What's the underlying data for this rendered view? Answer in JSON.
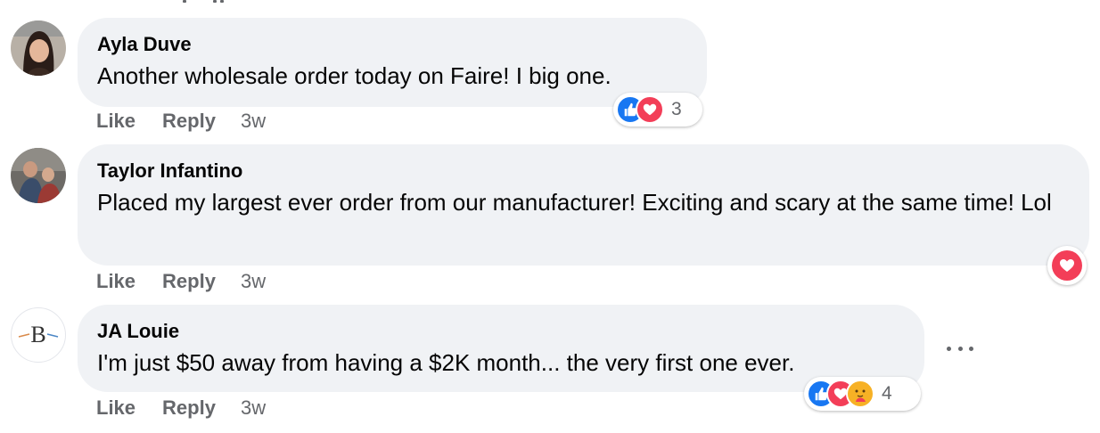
{
  "comments": [
    {
      "author": "Ayla Duve",
      "text": "Another wholesale order today on Faire! I big one.",
      "actions": {
        "like": "Like",
        "reply": "Reply",
        "time": "3w"
      },
      "reactions": {
        "types": [
          "like",
          "love"
        ],
        "count": "3"
      }
    },
    {
      "author": "Taylor Infantino",
      "text": "Placed my largest ever order from our manufacturer! Exciting and scary at the same time! Lol",
      "actions": {
        "like": "Like",
        "reply": "Reply",
        "time": "3w"
      },
      "reactions": {
        "types": [
          "love"
        ],
        "count": ""
      }
    },
    {
      "author": "JA Louie",
      "avatar_letter": "B",
      "text": "I'm just $50 away from having a $2K month... the very first one ever.",
      "actions": {
        "like": "Like",
        "reply": "Reply",
        "time": "3w"
      },
      "reactions": {
        "types": [
          "like",
          "love",
          "care"
        ],
        "count": "4"
      }
    }
  ],
  "colors": {
    "bubble_bg": "#f0f2f5",
    "like": "#1877f2",
    "love": "#f33e58",
    "care": "#f7b125",
    "secondary_text": "#65676b"
  }
}
